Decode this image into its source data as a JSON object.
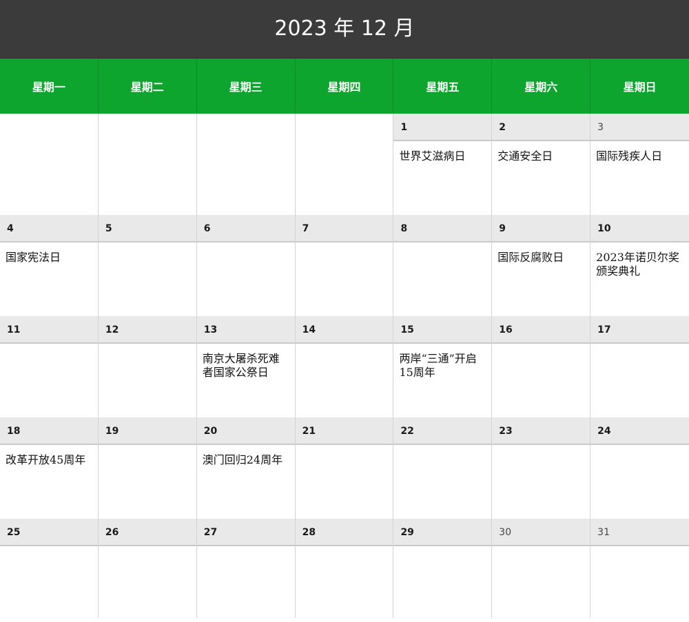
{
  "calendar": {
    "title": "2023 年 12 月",
    "weekdays": [
      "星期一",
      "星期二",
      "星期三",
      "星期四",
      "星期五",
      "星期六",
      "星期日"
    ],
    "weeks": [
      {
        "days": [
          "",
          "",
          "",
          "",
          "1",
          "2",
          "3"
        ],
        "events": [
          "",
          "",
          "",
          "",
          "世界艾滋病日",
          "交通安全日",
          "国际残疾人日"
        ]
      },
      {
        "days": [
          "4",
          "5",
          "6",
          "7",
          "8",
          "9",
          "10"
        ],
        "events": [
          "国家宪法日",
          "",
          "",
          "",
          "",
          "国际反腐败日",
          "2023年诺贝尔奖颁奖典礼"
        ]
      },
      {
        "days": [
          "11",
          "12",
          "13",
          "14",
          "15",
          "16",
          "17"
        ],
        "events": [
          "",
          "",
          "南京大屠杀死难者国家公祭日",
          "",
          "两岸“三通”开启15周年",
          "",
          ""
        ]
      },
      {
        "days": [
          "18",
          "19",
          "20",
          "21",
          "22",
          "23",
          "24"
        ],
        "events": [
          "改革开放45周年",
          "",
          "澳门回归24周年",
          "",
          "",
          "",
          ""
        ]
      },
      {
        "days": [
          "25",
          "26",
          "27",
          "28",
          "29",
          "30",
          "31"
        ],
        "events": [
          "",
          "",
          "",
          "",
          "",
          "",
          ""
        ]
      }
    ]
  }
}
